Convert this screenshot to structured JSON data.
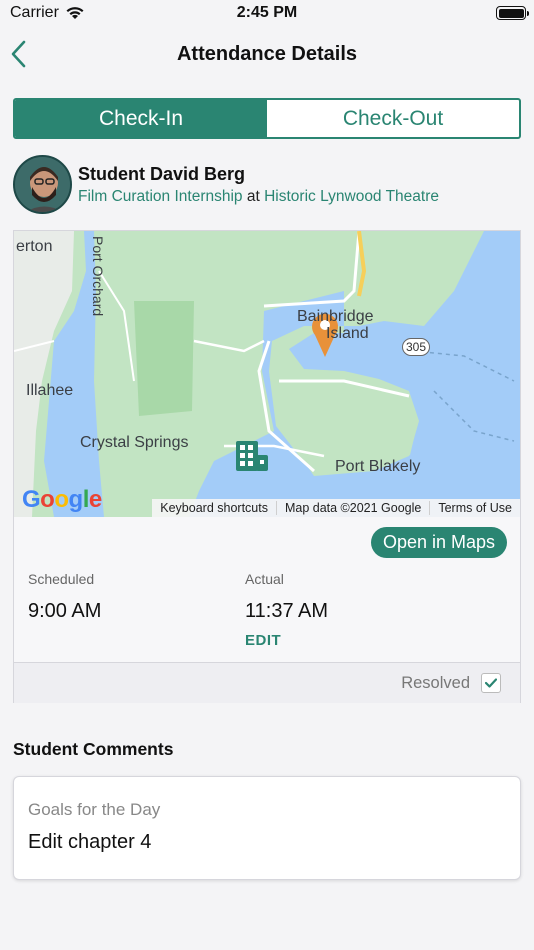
{
  "status_bar": {
    "carrier": "Carrier",
    "time": "2:45 PM",
    "battery_level": 1.0
  },
  "nav": {
    "title": "Attendance Details",
    "back_icon": "chevron-left-icon"
  },
  "segments": [
    {
      "label": "Check-In",
      "active": true
    },
    {
      "label": "Check-Out",
      "active": false
    }
  ],
  "student": {
    "name": "Student David Berg",
    "program": "Film Curation Internship",
    "connector": "at",
    "location": "Historic Lynwood Theatre"
  },
  "map": {
    "labels": {
      "erton": "erton",
      "port_orchard": "Port Orchard",
      "illahee": "Illahee",
      "crystal_springs": "Crystal Springs",
      "port_blakely": "Port Blakely",
      "bainbridge": "Bainbridge",
      "island": "Island",
      "route": "305"
    },
    "google": [
      "G",
      "o",
      "o",
      "g",
      "l",
      "e"
    ],
    "attribution": {
      "shortcuts": "Keyboard shortcuts",
      "data": "Map data ©2021 Google",
      "terms": "Terms of Use"
    },
    "open_button": "Open in Maps"
  },
  "times": {
    "scheduled_label": "Scheduled",
    "scheduled_value": "9:00 AM",
    "actual_label": "Actual",
    "actual_value": "11:37 AM",
    "edit_label": "EDIT"
  },
  "resolved": {
    "label": "Resolved",
    "checked": true
  },
  "comments": {
    "section_title": "Student Comments",
    "label": "Goals for the Day",
    "value": "Edit chapter 4"
  },
  "colors": {
    "accent": "#2a8572",
    "water": "#a3ccf8",
    "land": "#c2e4c3",
    "pin": "#e8913a"
  }
}
